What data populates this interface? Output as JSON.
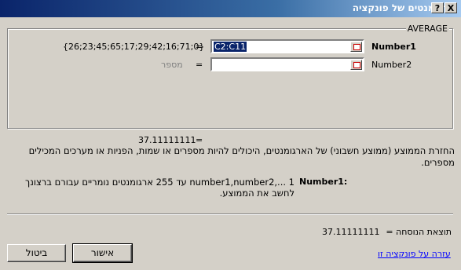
{
  "window": {
    "title": "ארגומנטים של פונקציה",
    "help_label": "?",
    "close_label": "X"
  },
  "group": {
    "function_name": "AVERAGE"
  },
  "args": [
    {
      "name": "Number1",
      "value": "C2:C11",
      "result": "{26;23;45;65;17;29;42;16;71;0}"
    },
    {
      "name": "Number2",
      "value": "",
      "result": "מספר"
    }
  ],
  "equals": "=",
  "function_result": "37.11111111",
  "description": "החזרת הממוצע (ממוצע חשבוני) של הארגומנטים, היכולים להיות מספרים או שמות, הפניות או מערכים המכילים מספרים.",
  "arg_help": {
    "name": "Number1:",
    "text": "number1,number2,... 1 עד 255 ארגומנטים נומריים עבורם ברצונך לחשב את הממוצע."
  },
  "formula_result": {
    "label": "תוצאת הנוסחה =",
    "value": "37.11111111"
  },
  "buttons": {
    "ok": "אישור",
    "cancel": "ביטול"
  },
  "help_link": "עזרה על פונקציה זו"
}
